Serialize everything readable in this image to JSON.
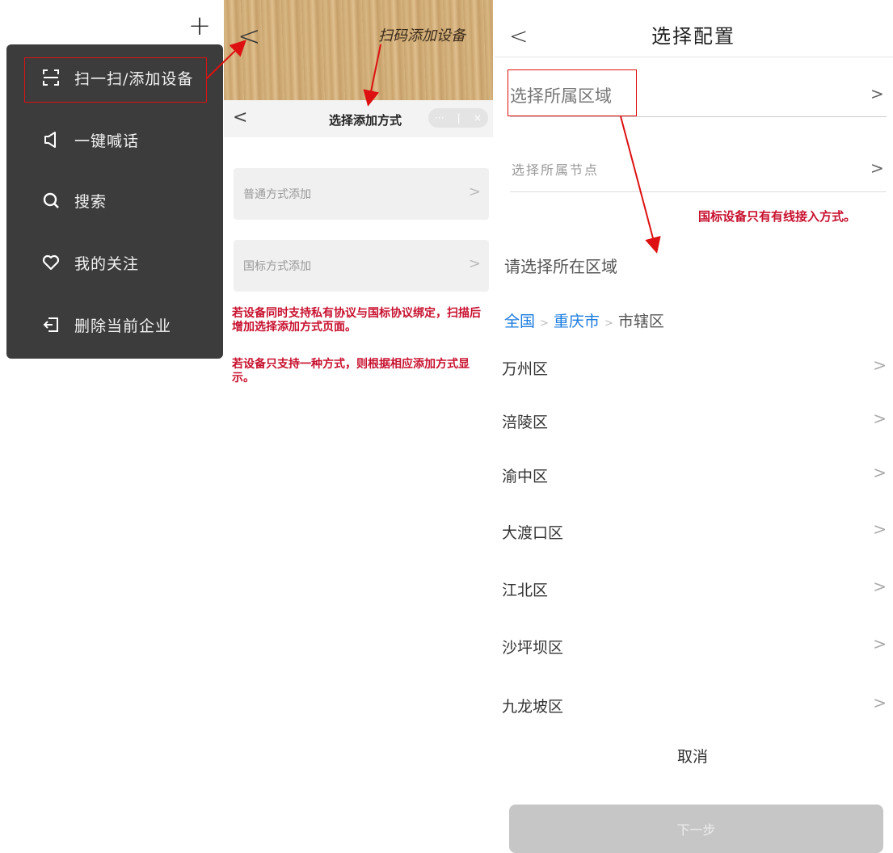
{
  "menu": {
    "plus": "+",
    "items": [
      {
        "label": "扫一扫/添加设备",
        "icon": "scan-icon"
      },
      {
        "label": "一键喊话",
        "icon": "speaker-icon"
      },
      {
        "label": "搜索",
        "icon": "search-icon"
      },
      {
        "label": "我的关注",
        "icon": "heart-icon"
      },
      {
        "label": "删除当前企业",
        "icon": "exit-icon"
      }
    ]
  },
  "scan": {
    "back": "<",
    "title": "扫码添加设备"
  },
  "add_method": {
    "back": "<",
    "title": "选择添加方式",
    "capsule_more": "···",
    "capsule_sep": "|",
    "capsule_close": "×",
    "options": [
      {
        "label": "普通方式添加",
        "chevron": ">"
      },
      {
        "label": "国标方式添加",
        "chevron": ">"
      }
    ],
    "note1": "若设备同时支持私有协议与国标协议绑定，扫描后增加选择添加方式页面。",
    "note2": "若设备只支持一种方式，则根据相应添加方式显示。"
  },
  "config": {
    "back": "<",
    "title": "选择配置",
    "area_label": "选择所属区域",
    "node_label": "选择所属节点",
    "chevron": ">",
    "note": "国标设备只有有线接入方式。",
    "region_title": "请选择所在区域",
    "breadcrumb": {
      "c1": "全国",
      "sep": ">",
      "c2": "重庆市",
      "c3": "市辖区"
    },
    "districts": [
      "万州区",
      "涪陵区",
      "渝中区",
      "大渡口区",
      "江北区",
      "沙坪坝区",
      "九龙坡区"
    ],
    "cancel": "取消",
    "next": "下一步"
  },
  "colors": {
    "accent_red": "#c8102e",
    "link_blue": "#1a7be0",
    "menu_bg": "#3c3c3c"
  }
}
